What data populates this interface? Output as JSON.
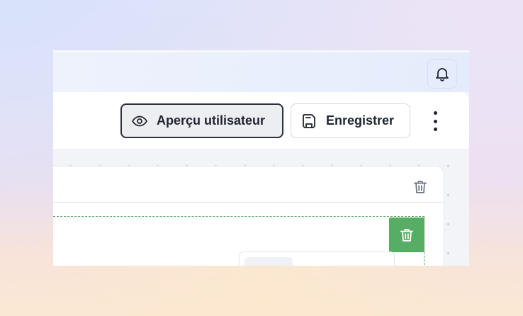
{
  "toolbar": {
    "preview_label": "Aperçu utilisateur",
    "save_label": "Enregistrer"
  },
  "icons": {
    "notifications": "bell-icon",
    "preview": "eye-icon",
    "save": "save-icon",
    "more": "more-vertical-icon",
    "card_delete": "trash-icon",
    "section_delete": "trash-icon"
  },
  "colors": {
    "section_accent": "#56ad63",
    "primary_text": "#1f2430"
  }
}
